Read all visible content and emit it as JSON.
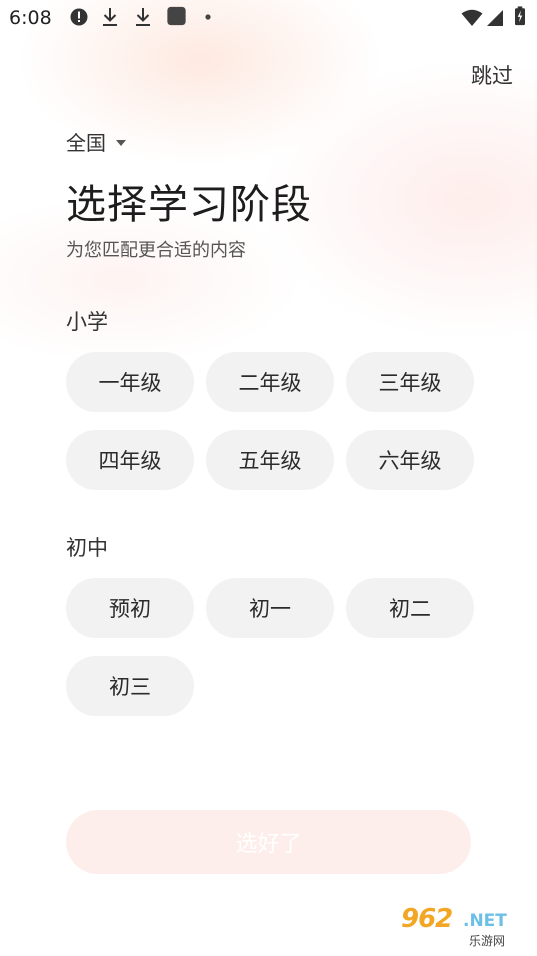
{
  "status_bar": {
    "time": "6:08"
  },
  "header": {
    "skip_label": "跳过",
    "region": "全国",
    "title": "选择学习阶段",
    "subtitle": "为您匹配更合适的内容"
  },
  "sections": [
    {
      "label": "小学",
      "grades": [
        "一年级",
        "二年级",
        "三年级",
        "四年级",
        "五年级",
        "六年级"
      ]
    },
    {
      "label": "初中",
      "grades": [
        "预初",
        "初一",
        "初二",
        "初三"
      ]
    }
  ],
  "confirm_label": "选好了",
  "watermark": {
    "number": "962",
    "net": ".NET",
    "sub": "乐游网"
  },
  "colors": {
    "chip_bg": "#f2f2f2",
    "confirm_disabled_bg": "#fdeeec",
    "glow": "#fde2d6"
  }
}
